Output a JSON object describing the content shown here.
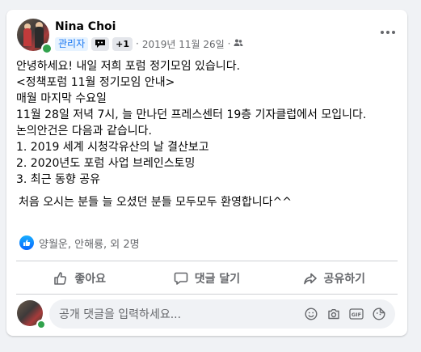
{
  "post": {
    "author": "Nina Choi",
    "admin_badge": "관리자",
    "plus_count": "+1",
    "separator": "·",
    "date": "2019년 11월 26일",
    "separator2": "·",
    "lines": [
      "안녕하세요! 내일 저희 포럼 정기모임 있습니다.",
      "<정책포럼 11월 정기모임 안내>",
      "매월 마지막 수요일",
      "11월 28일 저녁 7시, 늘 만나던 프레스센터 19층 기자클럽에서 모입니다.",
      "논의안건은 다음과 같습니다.",
      "1. 2019 세계 시청각유산의 날 결산보고",
      "2. 2020년도 포럼 사업 브레인스토밍",
      "3. 최근 동향 공유"
    ],
    "closing": "처음 오시는 분들 늘 오셨던 분들 모두모두 환영합니다^^",
    "reactions_text": "양월운, 안해룡, 외 2명"
  },
  "actions": {
    "like_label": "좋아요",
    "comment_label": "댓글 달기",
    "share_label": "공유하기"
  },
  "comment": {
    "placeholder": "공개 댓글을 입력하세요..."
  },
  "colors": {
    "accent": "#1877f2",
    "online": "#31a24c",
    "muted_text": "#65676b"
  }
}
